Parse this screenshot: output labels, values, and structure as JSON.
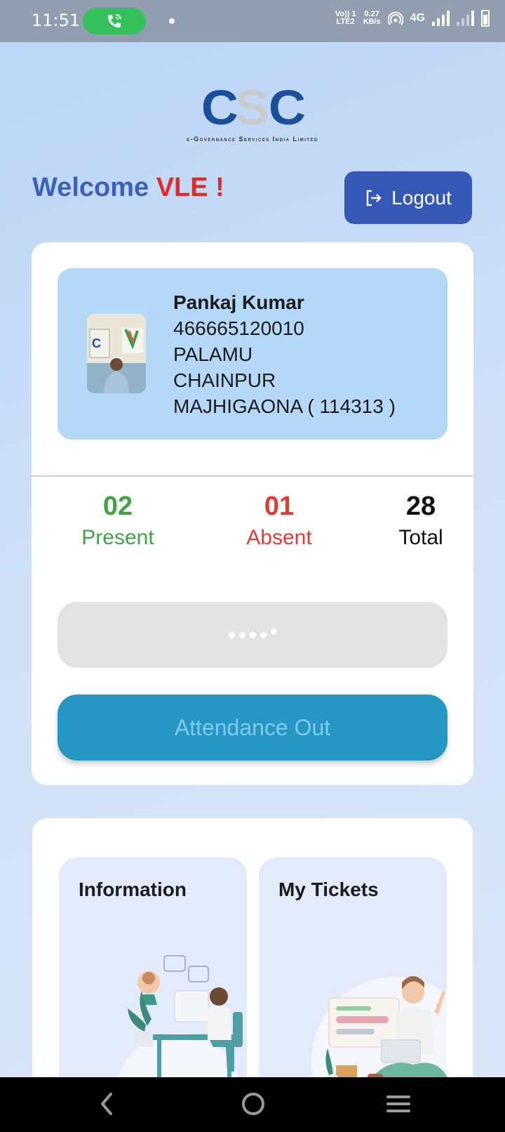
{
  "status_bar": {
    "time": "11:51",
    "volte_top": "Vo)) 1",
    "volte_bottom": "LTE2",
    "speed_value": "0.27",
    "speed_unit": "KB/s",
    "network": "4G",
    "call_icon": "phone-icon",
    "call_pill_color": "#34c05a"
  },
  "logo": {
    "letters": [
      "C",
      "S",
      "C"
    ],
    "subtitle": "e-Governance Services India Limited"
  },
  "header": {
    "welcome_text": "Welcome",
    "welcome_highlight": "VLE !",
    "logout_label": "Logout",
    "logout_icon": "logout-icon",
    "logout_color": "#3558b6"
  },
  "profile": {
    "name": "Pankaj Kumar",
    "id": "466665120010",
    "district": "PALAMU",
    "block": "CHAINPUR",
    "panchayat": "MAJHIGAONA ( 114313 )"
  },
  "stats": {
    "present_value": "02",
    "present_label": "Present",
    "absent_value": "01",
    "absent_label": "Absent",
    "total_value": "28",
    "total_label": "Total",
    "present_color": "#43a147",
    "absent_color": "#e03c35"
  },
  "attendance": {
    "button_label": "Attendance Out",
    "button_color": "#2697c3"
  },
  "menu": {
    "tiles": [
      {
        "title": "Information",
        "icon": "support-agent-illustration"
      },
      {
        "title": "My Tickets",
        "icon": "ticket-user-illustration"
      }
    ]
  },
  "nav": {
    "back_icon": "back-icon",
    "home_icon": "home-icon",
    "menu_icon": "menu-icon"
  }
}
